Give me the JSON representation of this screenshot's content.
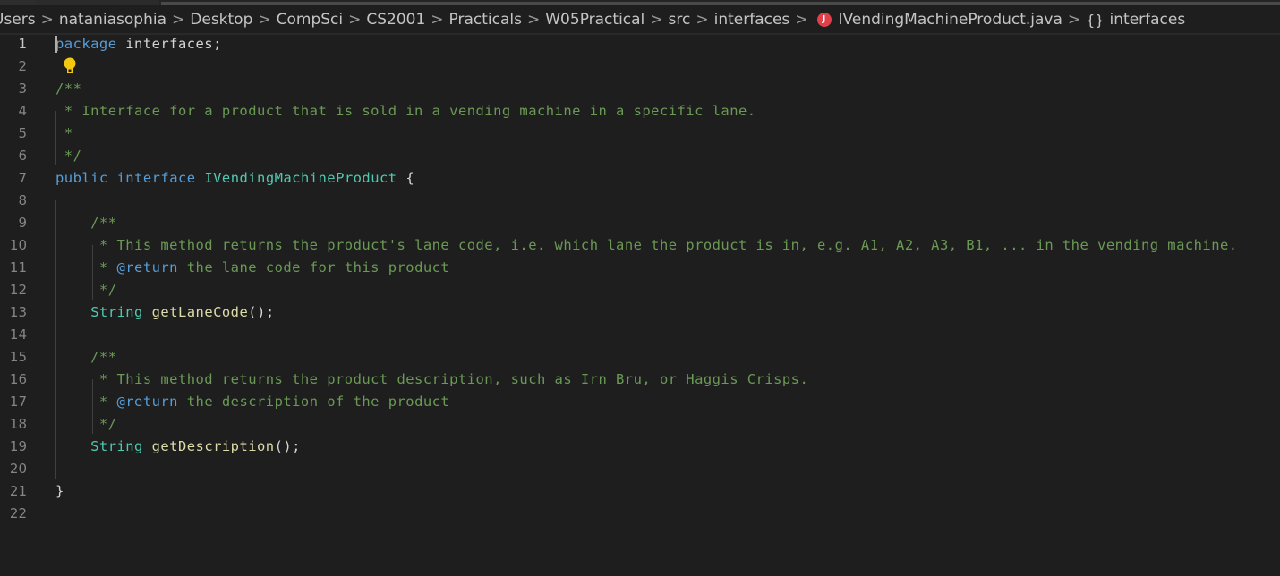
{
  "breadcrumb": {
    "items": [
      {
        "label": "Users"
      },
      {
        "label": "nataniasophia"
      },
      {
        "label": "Desktop"
      },
      {
        "label": "CompSci"
      },
      {
        "label": "CS2001"
      },
      {
        "label": "Practicals"
      },
      {
        "label": "W05Practical"
      },
      {
        "label": "src"
      },
      {
        "label": "interfaces"
      },
      {
        "label": "IVendingMachineProduct.java",
        "icon": "java-file-icon",
        "icon_glyph": "J",
        "icon_color": "#e0404a"
      },
      {
        "label": "interfaces",
        "icon": "namespace-icon",
        "icon_glyph": "{}"
      }
    ],
    "separator": ">"
  },
  "editor": {
    "line_numbers": [
      "1",
      "2",
      "3",
      "4",
      "5",
      "6",
      "7",
      "8",
      "9",
      "10",
      "11",
      "12",
      "13",
      "14",
      "15",
      "16",
      "17",
      "18",
      "19",
      "20",
      "21",
      "22"
    ],
    "current_line": 1,
    "lightbulb_line": 2,
    "lines": [
      [
        {
          "t": "kw",
          "v": "package"
        },
        {
          "t": "pl",
          "v": " interfaces;"
        }
      ],
      [],
      [
        {
          "t": "cm",
          "v": "/**"
        }
      ],
      [
        {
          "t": "cm",
          "v": " * Interface for a product that is sold in a vending machine in a specific lane."
        }
      ],
      [
        {
          "t": "cm",
          "v": " *"
        }
      ],
      [
        {
          "t": "cm",
          "v": " */"
        }
      ],
      [
        {
          "t": "kw",
          "v": "public"
        },
        {
          "t": "pl",
          "v": " "
        },
        {
          "t": "kw",
          "v": "interface"
        },
        {
          "t": "pl",
          "v": " "
        },
        {
          "t": "type",
          "v": "IVendingMachineProduct"
        },
        {
          "t": "pl",
          "v": " {"
        }
      ],
      [],
      [
        {
          "t": "cm",
          "v": "    /**"
        }
      ],
      [
        {
          "t": "cm",
          "v": "     * This method returns the product's lane code, i.e. which lane the product is in, e.g. A1, A2, A3, B1, ... in the vending machine."
        }
      ],
      [
        {
          "t": "cm",
          "v": "     * "
        },
        {
          "t": "tag",
          "v": "@return"
        },
        {
          "t": "cm",
          "v": " the lane code for this product"
        }
      ],
      [
        {
          "t": "cm",
          "v": "     */"
        }
      ],
      [
        {
          "t": "pl",
          "v": "    "
        },
        {
          "t": "type",
          "v": "String"
        },
        {
          "t": "pl",
          "v": " "
        },
        {
          "t": "fn",
          "v": "getLaneCode"
        },
        {
          "t": "pl",
          "v": "();"
        }
      ],
      [],
      [
        {
          "t": "cm",
          "v": "    /**"
        }
      ],
      [
        {
          "t": "cm",
          "v": "     * This method returns the product description, such as Irn Bru, or Haggis Crisps."
        }
      ],
      [
        {
          "t": "cm",
          "v": "     * "
        },
        {
          "t": "tag",
          "v": "@return"
        },
        {
          "t": "cm",
          "v": " the description of the product"
        }
      ],
      [
        {
          "t": "cm",
          "v": "     */"
        }
      ],
      [
        {
          "t": "pl",
          "v": "    "
        },
        {
          "t": "type",
          "v": "String"
        },
        {
          "t": "pl",
          "v": " "
        },
        {
          "t": "fn",
          "v": "getDescription"
        },
        {
          "t": "pl",
          "v": "();"
        }
      ],
      [],
      [
        {
          "t": "pl",
          "v": "}"
        }
      ],
      []
    ]
  }
}
